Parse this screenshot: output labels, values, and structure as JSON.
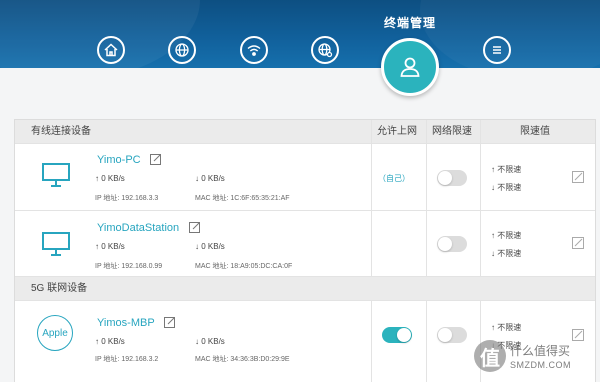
{
  "header": {
    "title": "终端管理",
    "nav": [
      {
        "name": "home-icon"
      },
      {
        "name": "globe-icon"
      },
      {
        "name": "wifi-icon"
      },
      {
        "name": "globe-settings-icon"
      },
      {
        "name": "menu-icon"
      }
    ],
    "active_icon": "user-icon"
  },
  "table": {
    "columns": {
      "wired": "有线连接设备",
      "allow": "允许上网",
      "throttle": "网络限速",
      "limit": "限速值"
    },
    "section_5g": "5G 联网设备",
    "devices": [
      {
        "name": "Yimo-PC",
        "up": "↑ 0 KB/s",
        "down": "↓ 0 KB/s",
        "ip": "IP 地址: 192.168.3.3",
        "mac": "MAC 地址: 1C:6F:65:35:21:AF",
        "self_label": "（自己）",
        "throttle_on": false,
        "limit_up": "↑ 不限速",
        "limit_down": "↓ 不限速"
      },
      {
        "name": "YimoDataStation",
        "up": "↑ 0 KB/s",
        "down": "↓ 0 KB/s",
        "ip": "IP 地址: 192.168.0.99",
        "mac": "MAC 地址: 18:A9:05:DC:CA:0F",
        "throttle_on": false,
        "limit_up": "↑ 不限速",
        "limit_down": "↓ 不限速"
      },
      {
        "name": "Yimos-MBP",
        "logo": "Apple",
        "up": "↑ 0 KB/s",
        "down": "↓ 0 KB/s",
        "ip": "IP 地址: 192.168.3.2",
        "mac": "MAC 地址: 34:36:3B:D0:29:9E",
        "allow_on": true,
        "throttle_on": false,
        "limit_up": "↑ 不限速",
        "limit_down": "↓ 不限速"
      }
    ]
  },
  "watermark": {
    "badge": "值",
    "text": "什么值得买",
    "url": "SMZDM.COM"
  },
  "colors": {
    "accent": "#2bb3bd",
    "header": "#11609b",
    "link": "#27a5bf"
  }
}
